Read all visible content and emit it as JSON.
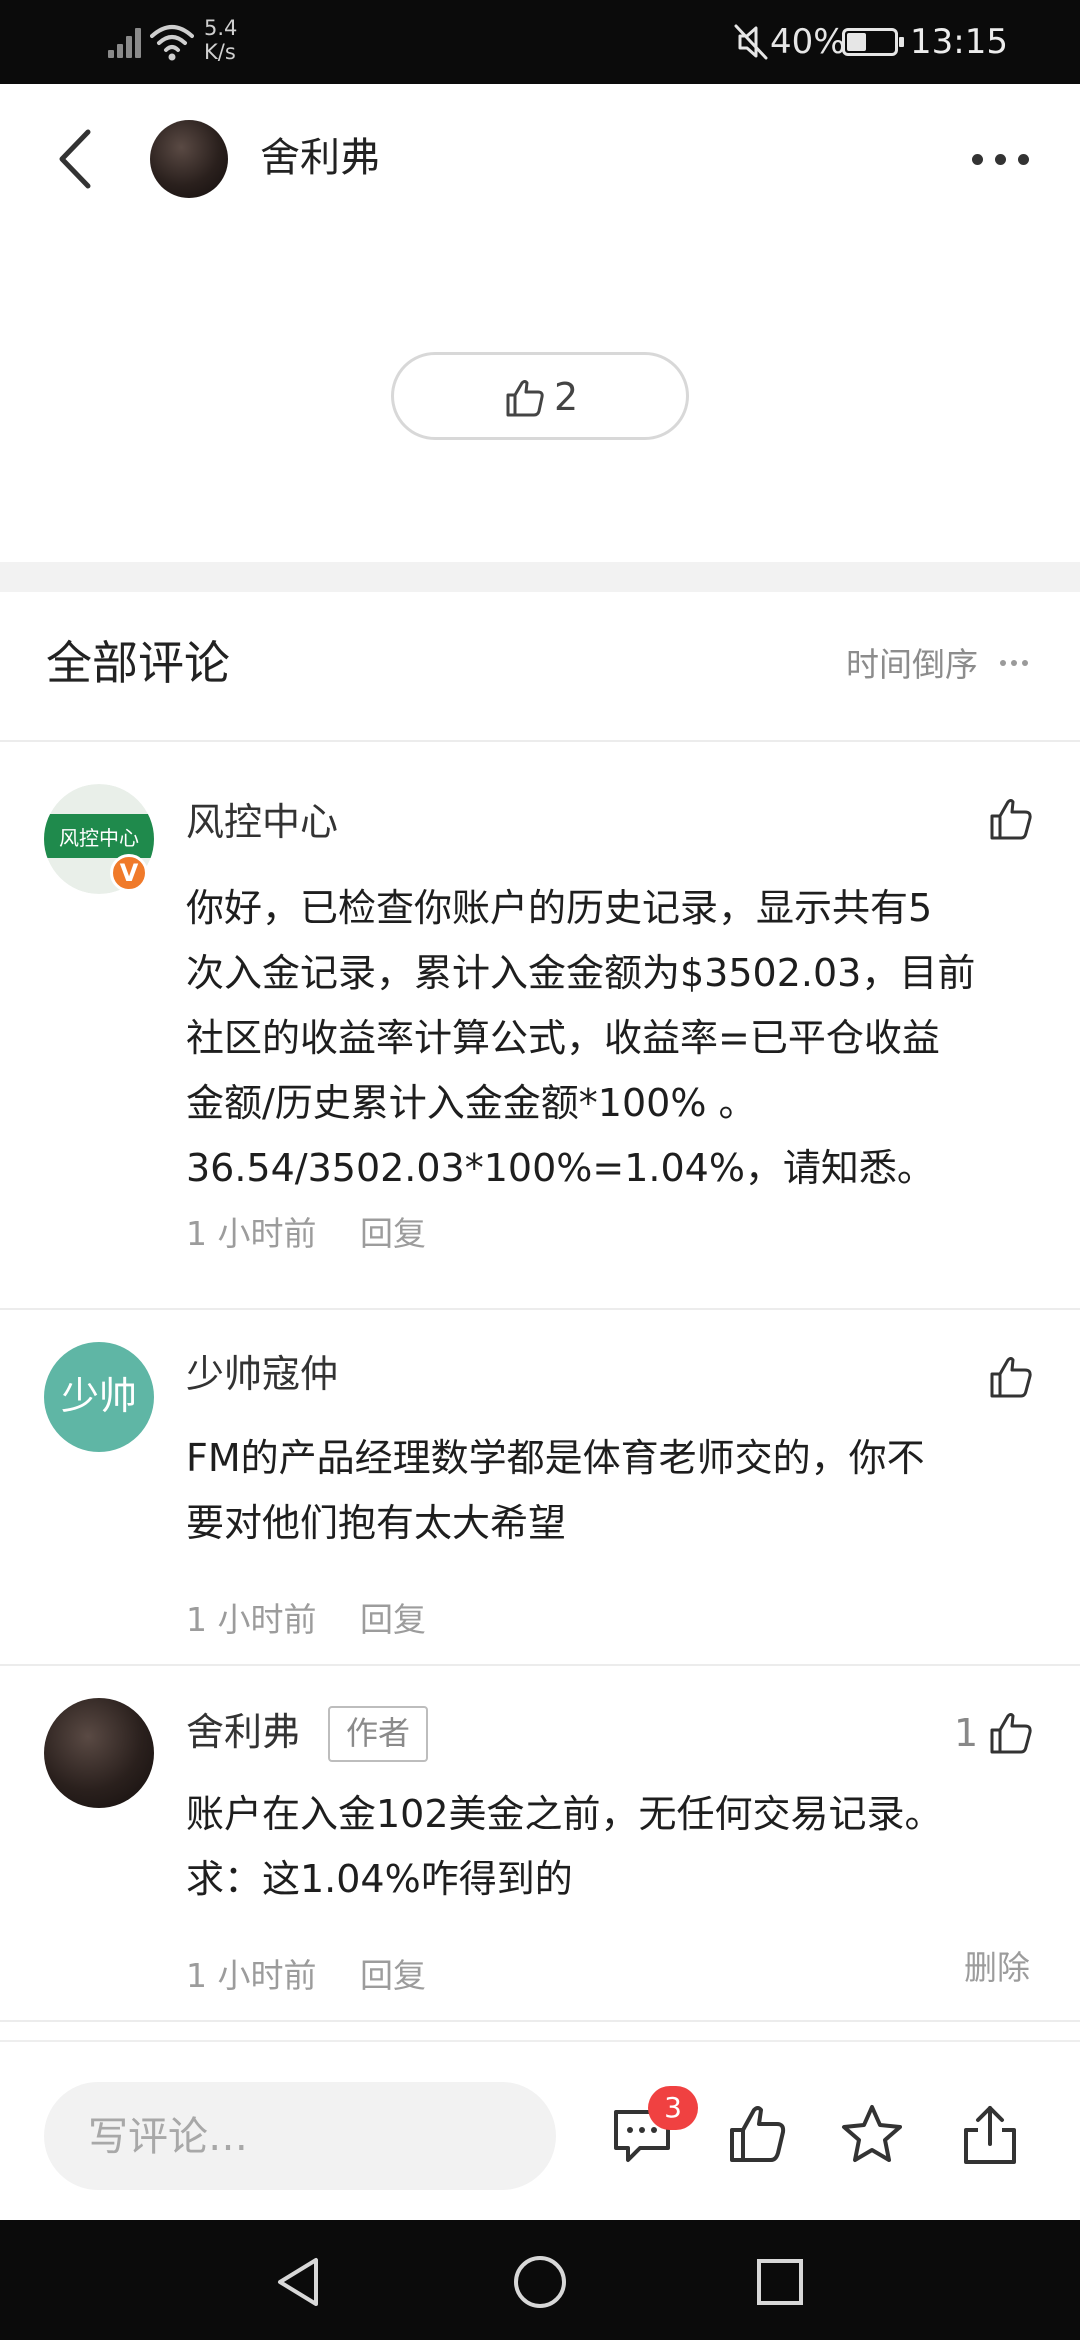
{
  "status_bar": {
    "network_speed_value": "5.4",
    "network_speed_unit": "K/s",
    "battery_percent": "40%",
    "battery_level": 0.4,
    "time": "13:15",
    "icons": [
      "signal-icon",
      "wifi-icon",
      "mute-icon",
      "battery-icon"
    ]
  },
  "header": {
    "author_name": "舍利弗",
    "icons": [
      "back-icon",
      "more-icon"
    ]
  },
  "post": {
    "like_count": "2"
  },
  "comments_section": {
    "title": "全部评论",
    "sort_label": "时间倒序"
  },
  "comments": [
    {
      "name": "风控中心",
      "avatar_text": "风控中心",
      "verified_badge": "V",
      "text_lines": [
        "你好，已检查你账户的历史记录，显示共有5",
        "次入金记录，累计入金金额为$3502.03，目前",
        "社区的收益率计算公式，收益率=已平仓收益",
        "金额/历史累计入金金额*100% 。",
        "36.54/3502.03*100%=1.04%，请知悉。"
      ],
      "time": "1 小时前",
      "reply_label": "回复"
    },
    {
      "name": "少帅寇仲",
      "avatar_text": "少帅",
      "text_lines": [
        "FM的产品经理数学都是体育老师交的，你不",
        "要对他们抱有太大希望"
      ],
      "time": "1 小时前",
      "reply_label": "回复"
    },
    {
      "name": "舍利弗",
      "author_tag": "作者",
      "like_count": "1",
      "text_lines": [
        "账户在入金102美金之前，无任何交易记录。",
        "求：这1.04%咋得到的"
      ],
      "time": "1 小时前",
      "reply_label": "回复",
      "delete_label": "删除"
    }
  ],
  "bottom_bar": {
    "input_placeholder": "写评论…",
    "comment_badge_count": "3",
    "icons": [
      "comment-icon",
      "like-icon",
      "star-icon",
      "share-icon"
    ]
  },
  "nav_bar": {
    "icons": [
      "nav-back-icon",
      "nav-home-icon",
      "nav-recents-icon"
    ]
  },
  "colors": {
    "badge_red": "#f04141",
    "verified_orange": "#f07a2a",
    "risk_avatar_green": "#1f8a4c",
    "shaoshuai_avatar_teal": "#5fb6a5"
  }
}
